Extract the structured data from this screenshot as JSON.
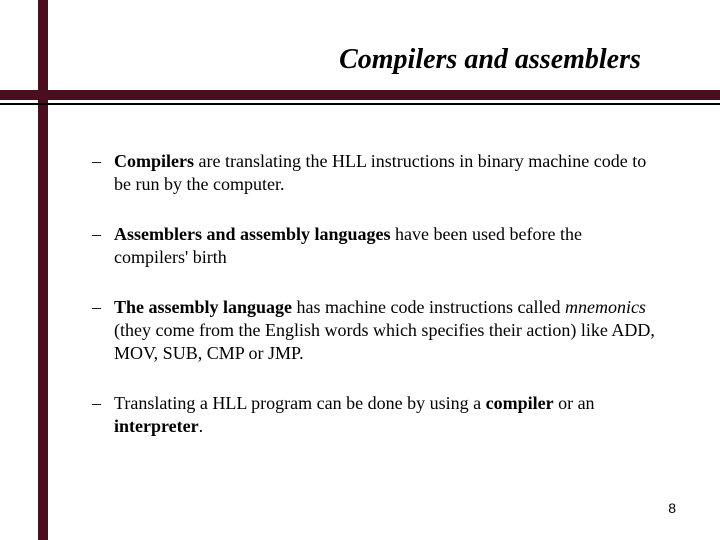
{
  "title": "Compilers and assemblers",
  "bullets": [
    {
      "dash": "–",
      "html": "<b>Compilers</b> are translating the HLL instructions in binary machine code to be run by the computer."
    },
    {
      "dash": "–",
      "html": "<b>Assemblers and assembly languages</b> have been used before the compilers' birth"
    },
    {
      "dash": "–",
      "html": "<b>The assembly language</b> has machine code instructions called <i>mnemonics</i> (they come from the English words which specifies their action) like ADD, MOV, SUB, CMP or JMP."
    },
    {
      "dash": "–",
      "html": "Translating a HLL program can be done by using a <b>compiler</b> or an <b>interpreter</b>."
    }
  ],
  "page_number": "8",
  "colors": {
    "maroon": "#4a0e1e"
  }
}
